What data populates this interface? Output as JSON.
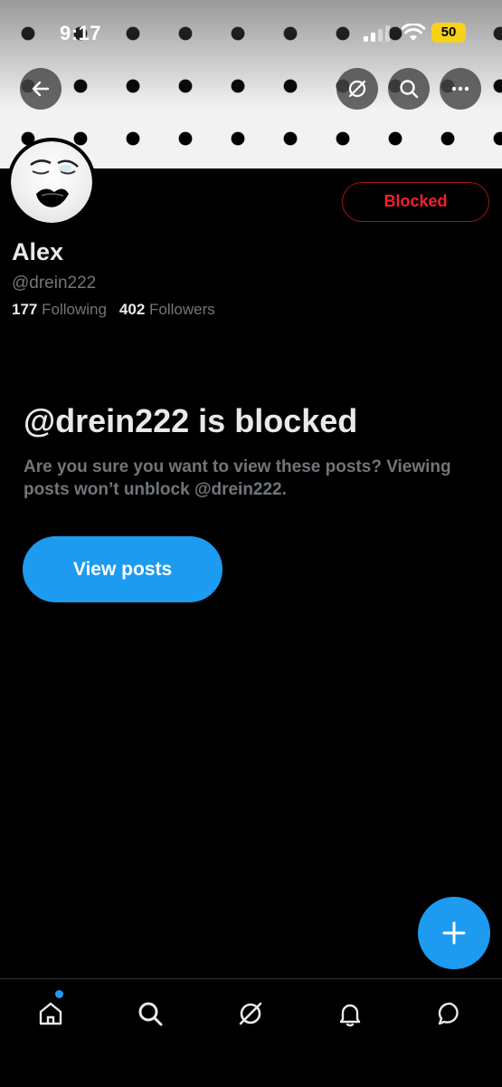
{
  "status_bar": {
    "time": "9:17",
    "battery": "50"
  },
  "profile": {
    "name": "Alex",
    "handle": "@drein222",
    "following_count": "177",
    "following_label": "Following",
    "followers_count": "402",
    "followers_label": "Followers",
    "relationship_button": "Blocked"
  },
  "blocked_notice": {
    "title": "@drein222 is blocked",
    "description": "Are you sure you want to view these posts? Viewing posts won’t unblock @drein222.",
    "view_button": "View posts"
  },
  "header_actions": [
    "back-arrow-icon",
    "grok-icon",
    "search-icon",
    "more-icon"
  ],
  "bottom_nav": [
    "home-icon",
    "search-icon",
    "grok-icon",
    "bell-icon",
    "message-icon"
  ],
  "colors": {
    "accent": "#1d9bf0",
    "blocked_red": "#f4212e",
    "background": "#000000",
    "muted": "#71767b"
  }
}
